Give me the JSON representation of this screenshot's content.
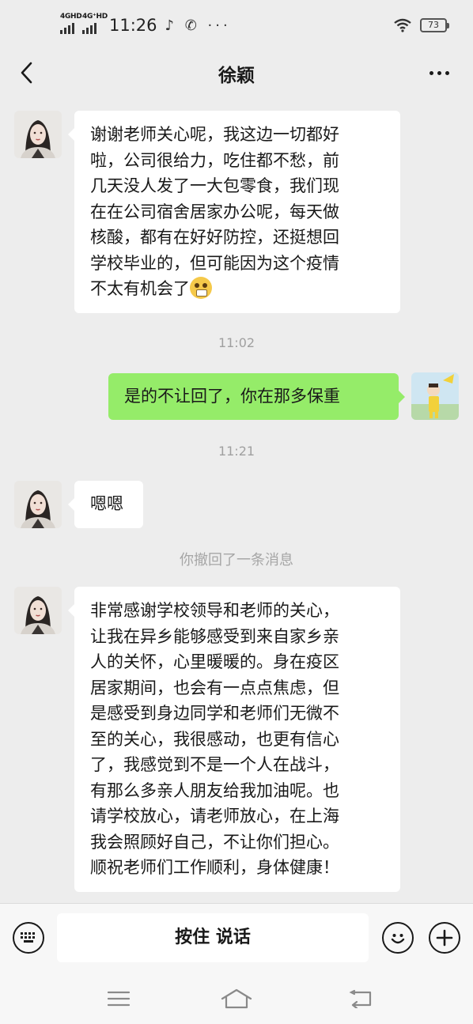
{
  "status_bar": {
    "sim1_tag": "4GHD",
    "sim2_tag": "4G⁺HD",
    "time": "11:26",
    "extra_icons": "♪ ✆ ···",
    "battery": "73",
    "wifi_icon": "wifi-icon"
  },
  "nav": {
    "title": "徐颖",
    "back_icon": "chevron-left-icon",
    "more_icon": "more-dots-icon"
  },
  "messages": [
    {
      "side": "left",
      "lines": [
        "谢谢老师关心呢，我这边一切都好",
        "啦，公司很给力，吃住都不愁，前",
        "几天没人发了一大包零食，我们现",
        "在在公司宿舍居家办公呢，每天做",
        "核酸，都有在好好防控，还挺想回",
        "学校毕业的，但可能因为这个疫情",
        "不太有机会了"
      ]
    },
    {
      "timestamp": "11:02"
    },
    {
      "side": "right",
      "lines": [
        "是的不让回了，你在那多保重"
      ]
    },
    {
      "timestamp": "11:21"
    },
    {
      "side": "left",
      "lines": [
        "嗯嗯"
      ]
    },
    {
      "system": "你撤回了一条消息"
    },
    {
      "side": "left",
      "lines": [
        "非常感谢学校领导和老师的关心，",
        "让我在异乡能够感受到来自家乡亲",
        "人的关怀，心里暖暖的。身在疫区",
        "居家期间，也会有一点点焦虑，但",
        "是感受到身边同学和老师们无微不",
        "至的关心，我很感动，也更有信心",
        "了，我感觉到不是一个人在战斗，",
        "有那么多亲人朋友给我加油呢。也",
        "请学校放心，请老师放心，在上海",
        "我会照顾好自己，不让你们担心。",
        "顺祝老师们工作顺利，身体健康！"
      ]
    }
  ],
  "input_bar": {
    "hold_to_talk": "按住 说话",
    "keyboard_icon": "keyboard-icon",
    "emoji_icon": "smiley-icon",
    "plus_icon": "plus-icon"
  },
  "system_nav": {
    "menu_icon": "menu-lines-icon",
    "home_icon": "home-icon",
    "back_icon": "return-icon"
  },
  "colors": {
    "background": "#ededed",
    "left_bubble": "#ffffff",
    "right_bubble": "#95ec69",
    "timestamp_text": "#a0a0a0"
  }
}
